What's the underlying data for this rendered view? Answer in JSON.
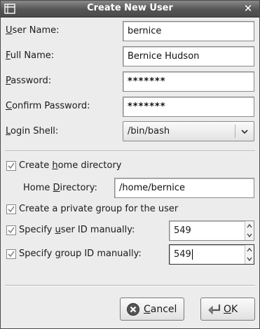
{
  "window": {
    "title": "Create New User",
    "close_symbol": "✕",
    "title_icon": "window-menu-icon"
  },
  "form": {
    "username": {
      "label": "User Name:",
      "value": "bernice"
    },
    "fullname": {
      "label": "Full Name:",
      "value": "Bernice Hudson"
    },
    "password": {
      "label": "Password:",
      "value": "*******"
    },
    "confirm": {
      "label": "Confirm Password:",
      "value": "*******"
    },
    "shell": {
      "label": "Login Shell:",
      "value": "/bin/bash"
    }
  },
  "options": {
    "create_home": {
      "label": "Create home directory",
      "checked": true
    },
    "home_dir": {
      "label": "Home Directory:",
      "value": "/home/bernice"
    },
    "private_group": {
      "label": "Create a private group for the user",
      "checked": true
    },
    "user_id": {
      "label": "Specify user ID manually:",
      "value": "549",
      "checked": true
    },
    "group_id": {
      "label": "Specify group ID manually:",
      "value": "549",
      "checked": true
    }
  },
  "buttons": {
    "cancel": "Cancel",
    "ok": "OK"
  },
  "colors": {
    "title_bar": "#5e5e5e",
    "dialog_bg": "#ececec",
    "check_mark": "#8a8a8a"
  }
}
